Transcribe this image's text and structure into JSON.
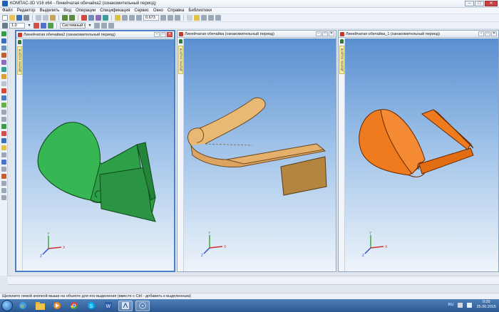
{
  "app": {
    "title": "КОМПАС-3D V16  x64 - Линейчатая обечайка2 (ознакомительный период)"
  },
  "window_controls": {
    "minimize": "–",
    "maximize": "□",
    "close": "✕"
  },
  "menu": [
    "Файл",
    "Редактор",
    "Выделить",
    "Вид",
    "Операции",
    "Спецификация",
    "Сервис",
    "Окно",
    "Справка",
    "Библиотеки"
  ],
  "toolbar": {
    "zoom_value": "0.673",
    "line_width": "1.0",
    "style_value": "Системный сл"
  },
  "documents": [
    {
      "title": "Линейчатая обечайка2 (ознакомительный период)",
      "tree_tab": "Дерево модели",
      "model_color": "#2ea04a",
      "active": true
    },
    {
      "title": "Линейчатая обечайка (ознакомительный период)",
      "tree_tab": "Дерево модели",
      "model_color": "#e2ad62",
      "active": false
    },
    {
      "title": "Линейчатая обечайка_1 (ознакомительный период)",
      "tree_tab": "Дерево модели",
      "model_color": "#f07a1e",
      "active": false
    }
  ],
  "axes": {
    "x": "X",
    "y": "Y",
    "z": "Z"
  },
  "status_bar": {
    "text": "Щелкните левой кнопкой мыши на объекте для его выделения (вместе с Ctrl - добавить к выделенным)"
  },
  "taskbar": {
    "apps": [
      "ie-icon",
      "explorer-icon",
      "media-icon",
      "chrome-icon",
      "skype-icon",
      "word-icon",
      "kompas-icon",
      "kompas-doc-icon"
    ],
    "language": "RU",
    "time": "0:20",
    "date": "25.06.2015"
  }
}
